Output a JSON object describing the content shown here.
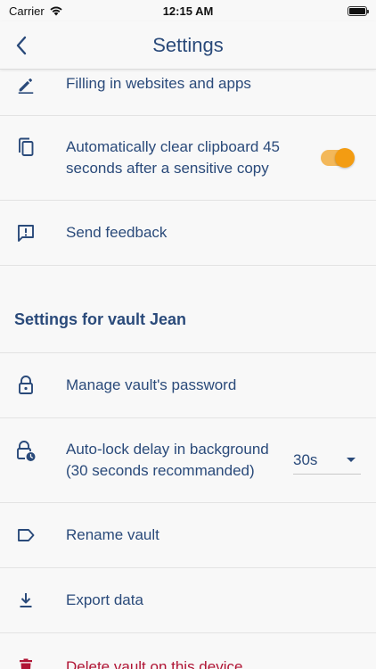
{
  "status_bar": {
    "carrier": "Carrier",
    "time": "12:15 AM"
  },
  "nav": {
    "title": "Settings"
  },
  "general_items": [
    {
      "label": "Filling in websites and apps",
      "icon": "pencil-icon"
    },
    {
      "label": "Automatically clear clipboard 45 seconds after a sensitive copy",
      "icon": "copy-icon",
      "toggle_on": true
    },
    {
      "label": "Send feedback",
      "icon": "feedback-icon"
    }
  ],
  "vault_section": {
    "header": "Settings for vault Jean",
    "items": [
      {
        "label": "Manage vault's password",
        "icon": "lock-icon"
      },
      {
        "label": "Auto-lock delay in background (30 seconds recommanded)",
        "icon": "lock-clock-icon",
        "select_value": "30s"
      },
      {
        "label": "Rename vault",
        "icon": "label-icon"
      },
      {
        "label": "Export data",
        "icon": "download-icon"
      },
      {
        "label": "Delete vault on this device",
        "icon": "trash-icon"
      }
    ]
  },
  "colors": {
    "primary": "#2a4a7a",
    "accent": "#f39c12",
    "danger": "#b01535",
    "background": "#f8f8f8"
  }
}
